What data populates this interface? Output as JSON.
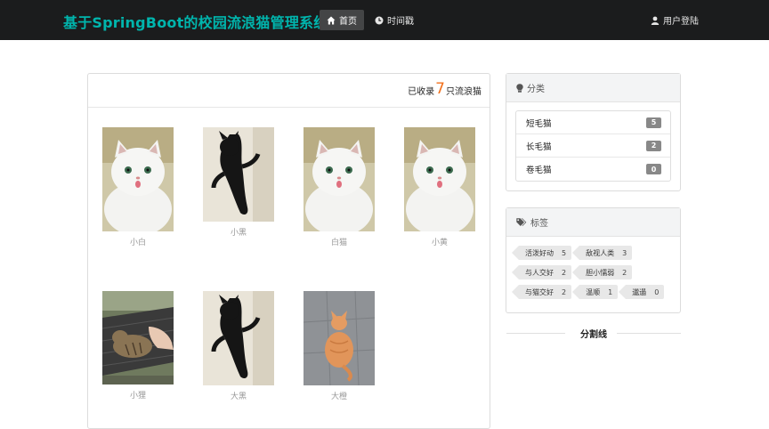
{
  "nav": {
    "brand": "基于SpringBoot的校园流浪猫管理系统",
    "home_label": "首页",
    "timeline_label": "时间戳",
    "login_label": "用户登陆"
  },
  "summary": {
    "prefix": "已收录",
    "count": "7",
    "suffix": "只流浪猫"
  },
  "cats": [
    {
      "name": "小白",
      "photo": "white-cat"
    },
    {
      "name": "小黑",
      "photo": "black-cat"
    },
    {
      "name": "白猫",
      "photo": "white-cat"
    },
    {
      "name": "小黄",
      "photo": "white-cat"
    },
    {
      "name": "小狸",
      "photo": "tabby-cat"
    },
    {
      "name": "大黑",
      "photo": "black-cat"
    },
    {
      "name": "大橙",
      "photo": "orange-cat"
    }
  ],
  "categories": {
    "title": "分类",
    "items": [
      {
        "label": "短毛猫",
        "count": "5"
      },
      {
        "label": "长毛猫",
        "count": "2"
      },
      {
        "label": "卷毛猫",
        "count": "0"
      }
    ]
  },
  "tags": {
    "title": "标签",
    "items": [
      {
        "label": "活泼好动",
        "count": "5"
      },
      {
        "label": "敌视人类",
        "count": "3"
      },
      {
        "label": "与人交好",
        "count": "2"
      },
      {
        "label": "胆小懦弱",
        "count": "2"
      },
      {
        "label": "与猫交好",
        "count": "2"
      },
      {
        "label": "温顺",
        "count": "1"
      },
      {
        "label": "邋遢",
        "count": "0"
      }
    ]
  },
  "divider": {
    "label": "分割线"
  },
  "colors": {
    "brand": "#00b5ad",
    "count_accent": "#f2711c",
    "navbar": "#1b1c1d"
  }
}
